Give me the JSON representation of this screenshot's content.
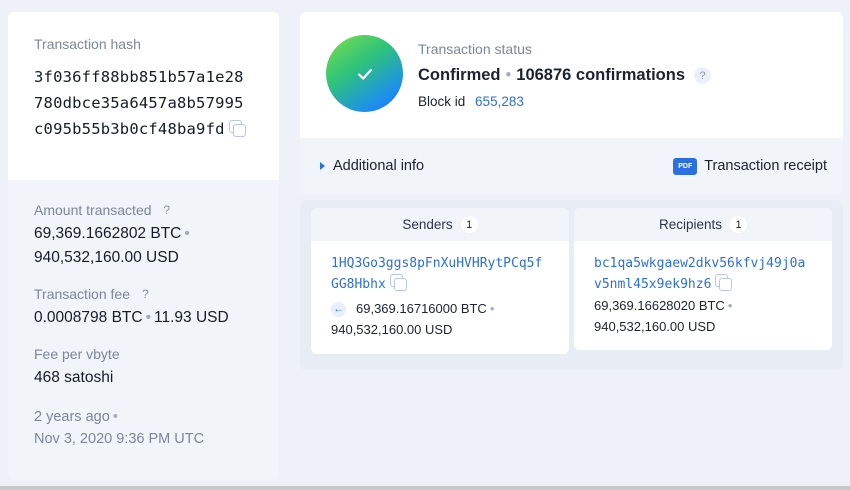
{
  "transaction_hash": {
    "label": "Transaction hash",
    "value": "3f036ff88bb851b57a1e28780dbce35a6457a8b57995c095b55b3b0cf48ba9fd"
  },
  "amount": {
    "label": "Amount transacted",
    "btc": "69,369.1662802 BTC",
    "usd": "940,532,160.00 USD"
  },
  "fee": {
    "label": "Transaction fee",
    "btc": "0.0008798 BTC",
    "usd": "11.93 USD"
  },
  "fee_per_vbyte": {
    "label": "Fee per vbyte",
    "value": "468 satoshi"
  },
  "time": {
    "relative": "2 years ago",
    "absolute": "Nov 3, 2020 9:36 PM UTC"
  },
  "status": {
    "label": "Transaction status",
    "state": "Confirmed",
    "confirmations": "106876 confirmations",
    "block_label": "Block id",
    "block_id": "655,283"
  },
  "actions": {
    "additional_info": "Additional info",
    "receipt": "Transaction receipt",
    "pdf_badge": "PDF"
  },
  "senders": {
    "title": "Senders",
    "count": "1",
    "items": [
      {
        "address": "1HQ3Go3ggs8pFnXuHVHRytPCq5fGG8Hbhx",
        "btc": "69,369.16716000 BTC",
        "usd": "940,532,160.00 USD"
      }
    ]
  },
  "recipients": {
    "title": "Recipients",
    "count": "1",
    "items": [
      {
        "address": "bc1qa5wkgaew2dkv56kfvj49j0av5nml45x9ek9hz6",
        "btc": "69,369.16628020 BTC",
        "usd": "940,532,160.00 USD"
      }
    ]
  },
  "icons": {
    "help": "?",
    "dot": "•",
    "arrow_left": "←"
  },
  "colors": {
    "accent": "#2d6fe0",
    "page_bg": "#eef1f7",
    "card_bg": "#ffffff",
    "panel_bg": "#f1f4f9"
  }
}
